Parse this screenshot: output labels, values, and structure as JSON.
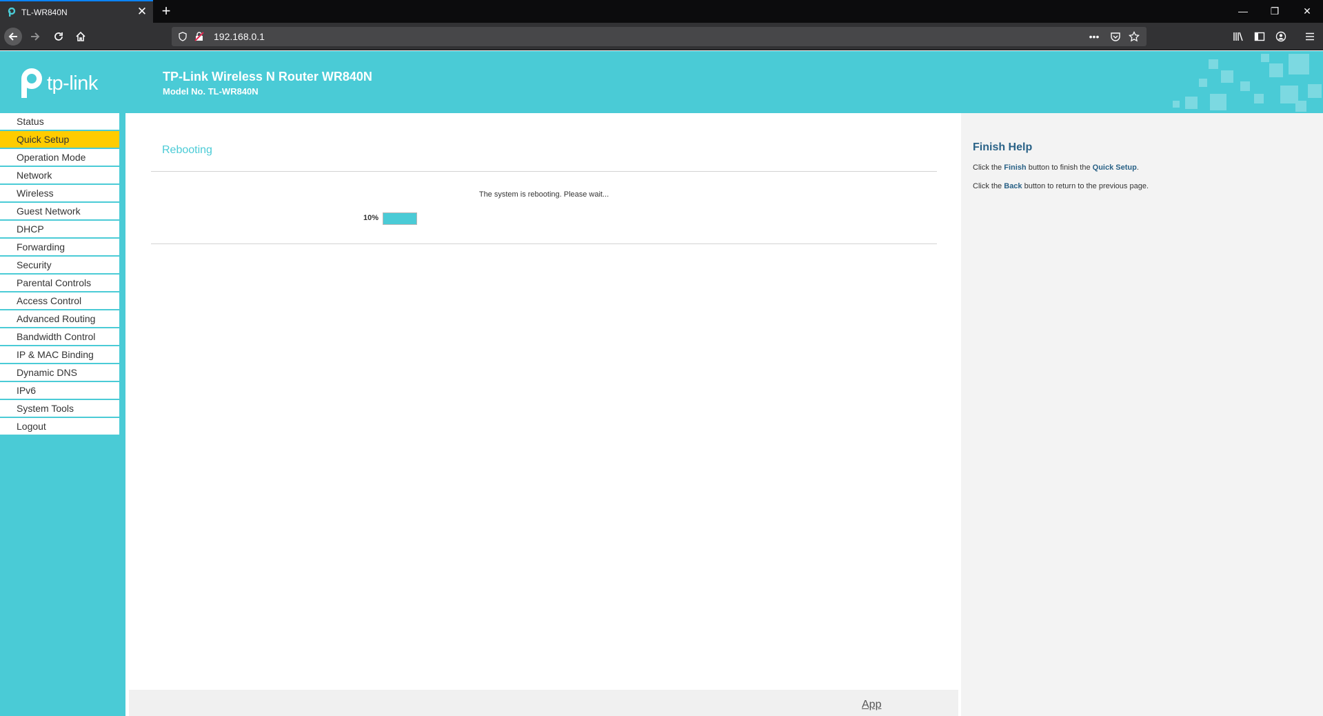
{
  "browser": {
    "tab": {
      "title": "TL-WR840N"
    },
    "url": "192.168.0.1",
    "window_controls": [
      "minimize-icon",
      "restore-icon",
      "close-icon"
    ]
  },
  "header": {
    "logo_text": "tp-link",
    "title": "TP-Link Wireless N Router WR840N",
    "model": "Model No. TL-WR840N"
  },
  "sidebar": {
    "active": "Quick Setup",
    "items": [
      {
        "label": "Status"
      },
      {
        "label": "Quick Setup"
      },
      {
        "label": "Operation Mode"
      },
      {
        "label": "Network"
      },
      {
        "label": "Wireless"
      },
      {
        "label": "Guest Network"
      },
      {
        "label": "DHCP"
      },
      {
        "label": "Forwarding"
      },
      {
        "label": "Security"
      },
      {
        "label": "Parental Controls"
      },
      {
        "label": "Access Control"
      },
      {
        "label": "Advanced Routing"
      },
      {
        "label": "Bandwidth Control"
      },
      {
        "label": "IP & MAC Binding"
      },
      {
        "label": "Dynamic DNS"
      },
      {
        "label": "IPv6"
      },
      {
        "label": "System Tools"
      },
      {
        "label": "Logout"
      }
    ]
  },
  "main": {
    "title": "Rebooting",
    "message": "The system is rebooting. Please wait...",
    "progress": {
      "label": "10%",
      "fraction": 0.1
    },
    "footer_link": "App"
  },
  "help": {
    "title": "Finish Help",
    "line1": {
      "pre": "Click the ",
      "button": "Finish",
      "mid": " button to finish the ",
      "target": "Quick Setup",
      "post": "."
    },
    "line2": {
      "pre": "Click the ",
      "button": "Back",
      "post": " button to return to the previous page."
    }
  },
  "colors": {
    "brand": "#4acbd6",
    "active_menu": "#ffcc00",
    "help_title": "#2a6287"
  }
}
